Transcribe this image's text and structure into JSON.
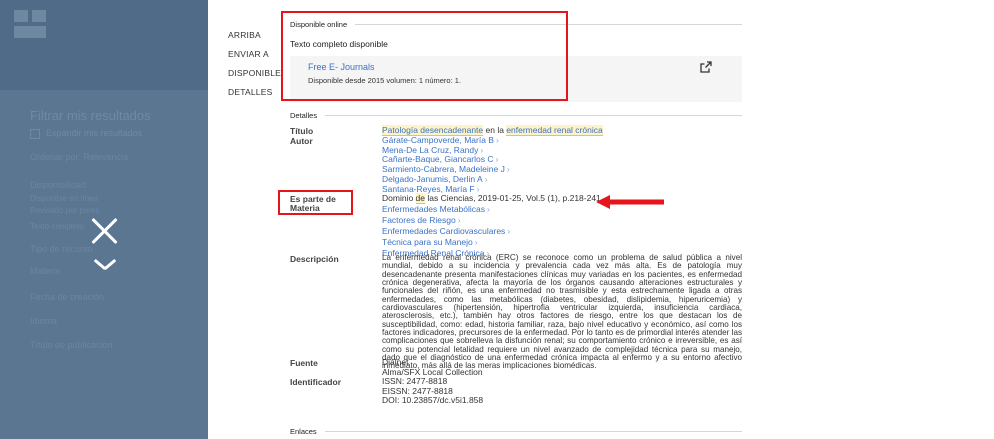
{
  "sidebar": {
    "filters_title": "Filtrar mis resultados",
    "filter_check": "Expandir mis resultados",
    "filter_lines": [
      "Ordenar por: Relevancia",
      "Disponibilidad",
      "Disponible en línea",
      "Revisado por pares",
      "Texto completo",
      "Tipo de recurso",
      "Materia",
      "Fecha de creación",
      "Idioma",
      "Título de publicación"
    ]
  },
  "nav": {
    "items": [
      "ARRIBA",
      "ENVIAR A",
      "DISPONIBLE",
      "DETALLES"
    ]
  },
  "availability": {
    "header": "Disponible online",
    "subtitle": "Texto completo disponible",
    "link": "Free E- Journals",
    "info": "Disponible desde 2015 volumen: 1 número: 1."
  },
  "details": {
    "header": "Detalles",
    "titulo_label": "Título",
    "title_parts": [
      "Patología desencadenante",
      " en la ",
      "enfermedad renal crónica"
    ],
    "autor_label": "Autor",
    "authors": [
      "Gárate-Campoverde, María B",
      "Mena-De La Cruz, Randy",
      "Cañarte-Baque, Giancarlos C",
      "Sarmiento-Cabrera, Madeleine J",
      "Delgado-Janumis, Derlin A",
      "Santana-Reyes, María F"
    ],
    "es_parte_label": "Es parte de",
    "es_parte_parts": [
      "Dominio ",
      "de",
      " las Ciencias, 2019-01-25, Vol.5 (1), p.218-241"
    ],
    "materia_label": "Materia",
    "subjects": [
      "Enfermedades Metabólicas",
      "Factores de Riesgo",
      "Enfermedades Cardiovasculares",
      "Técnica para su Manejo",
      "Enfermedad Renal Crónica"
    ],
    "descripcion_label": "Descripción",
    "description": "La enfermedad renal crónica (ERC) se reconoce como un problema de salud pública a nivel mundial, debido a su incidencia y prevalencia cada vez más alta. Es de patología muy desencadenante presenta manifestaciones clínicas muy variadas en los pacientes, es enfermedad crónica degenerativa, afecta la mayoría de los órganos causando alteraciones estructurales y funcionales del riñón, es una enfermedad no trasmisible y esta estrechamente ligada a otras enfermedades, como las metabólicas (diabetes, obesidad, dislipidemia, hiperuricemia) y cardiovasculares (hipertensión, hipertrofia ventricular izquierda, insuficiencia cardiaca, aterosclerosis, etc.), también hay otros factores de riesgo, entre los que destacan los de susceptibilidad, como: edad, historia familiar, raza, bajo nivel educativo y económico, así como los factores indicadores, precursores de la enfermedad. Por lo tanto es de primordial interés atender las complicaciones que sobrelleva la disfunción renal; su comportamiento crónico e irreversible, es así como su potencial letalidad requiere un nivel avanzado de complejidad técnica para su manejo, dado que el diagnóstico de una enfermedad crónica impacta al enfermo y a su entorno afectivo inmediato, más allá de las meras implicaciones biomédicas.",
    "fuente_label": "Fuente",
    "sources": [
      "Dialnet",
      "Alma/SFX Local Collection"
    ],
    "identificador_label": "Identificador",
    "identifiers": [
      "ISSN: 2477-8818",
      "EISSN: 2477-8818",
      "DOI: 10.23857/dc.v5i1.858"
    ]
  },
  "enlaces": {
    "header": "Enlaces"
  },
  "colors": {
    "annotation_red": "#e8141c",
    "link_blue": "#3a72c6",
    "sidebar_overlay": "#5a7690"
  },
  "icons": [
    "close-icon",
    "chevron-down-icon",
    "external-link-icon",
    "annotation-arrow-icon"
  ]
}
